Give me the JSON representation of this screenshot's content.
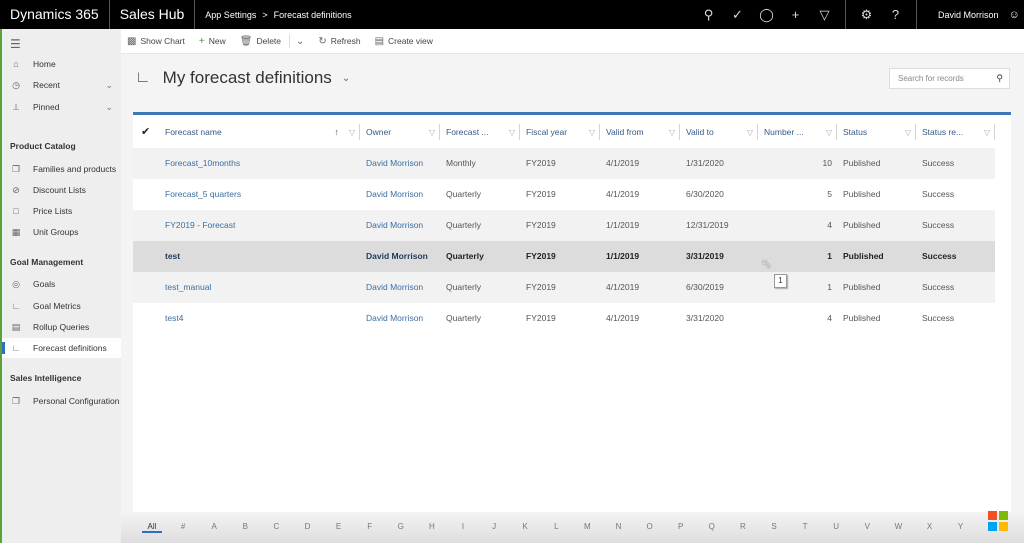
{
  "topbar": {
    "brand": "Dynamics 365",
    "app": "Sales Hub",
    "breadcrumb": [
      "App Settings",
      "Forecast definitions"
    ],
    "breadcrumb_sep": ">",
    "icons": [
      "search-icon",
      "task-icon",
      "lightbulb-icon",
      "plus-icon",
      "filter-icon",
      "gear-icon",
      "help-icon"
    ],
    "user": "David Morrison"
  },
  "sidebar": {
    "nav": [
      {
        "label": "Home",
        "icon": "home-icon"
      },
      {
        "label": "Recent",
        "icon": "clock-icon",
        "expandable": true
      },
      {
        "label": "Pinned",
        "icon": "pin-icon",
        "expandable": true
      }
    ],
    "sections": [
      {
        "title": "Product Catalog",
        "items": [
          {
            "label": "Families and products",
            "icon": "box-icon"
          },
          {
            "label": "Discount Lists",
            "icon": "discount-icon"
          },
          {
            "label": "Price Lists",
            "icon": "price-list-icon"
          },
          {
            "label": "Unit Groups",
            "icon": "unit-group-icon"
          }
        ]
      },
      {
        "title": "Goal Management",
        "items": [
          {
            "label": "Goals",
            "icon": "target-icon"
          },
          {
            "label": "Goal Metrics",
            "icon": "chart-line-icon"
          },
          {
            "label": "Rollup Queries",
            "icon": "document-icon"
          },
          {
            "label": "Forecast definitions",
            "icon": "forecast-icon",
            "active": true
          }
        ]
      },
      {
        "title": "Sales Intelligence",
        "items": [
          {
            "label": "Personal Configuration",
            "icon": "box-icon"
          }
        ]
      }
    ]
  },
  "commandbar": {
    "show_chart": "Show Chart",
    "new": "New",
    "delete": "Delete",
    "refresh": "Refresh",
    "create_view": "Create view"
  },
  "view": {
    "title": "My forecast definitions",
    "search_placeholder": "Search for records"
  },
  "grid": {
    "columns": [
      "Forecast name",
      "Owner",
      "Forecast ...",
      "Fiscal year",
      "Valid from",
      "Valid to",
      "Number ...",
      "Status",
      "Status re..."
    ],
    "sorted_column": "Forecast name",
    "sort_direction": "ascending",
    "rows": [
      {
        "name": "Forecast_10months",
        "owner": "David Morrison",
        "period": "Monthly",
        "fiscal_year": "FY2019",
        "valid_from": "4/1/2019",
        "valid_to": "1/31/2020",
        "number": "10",
        "status": "Published",
        "status_reason": "Success"
      },
      {
        "name": "Forecast_5 quarters",
        "owner": "David Morrison",
        "period": "Quarterly",
        "fiscal_year": "FY2019",
        "valid_from": "4/1/2019",
        "valid_to": "6/30/2020",
        "number": "5",
        "status": "Published",
        "status_reason": "Success"
      },
      {
        "name": "FY2019 - Forecast",
        "owner": "David Morrison",
        "period": "Quarterly",
        "fiscal_year": "FY2019",
        "valid_from": "1/1/2019",
        "valid_to": "12/31/2019",
        "number": "4",
        "status": "Published",
        "status_reason": "Success"
      },
      {
        "name": "test",
        "owner": "David Morrison",
        "period": "Quarterly",
        "fiscal_year": "FY2019",
        "valid_from": "1/1/2019",
        "valid_to": "3/31/2019",
        "number": "1",
        "status": "Published",
        "status_reason": "Success",
        "selected": true
      },
      {
        "name": "test_manual",
        "owner": "David Morrison",
        "period": "Quarterly",
        "fiscal_year": "FY2019",
        "valid_from": "4/1/2019",
        "valid_to": "6/30/2019",
        "number": "1",
        "status": "Published",
        "status_reason": "Success"
      },
      {
        "name": "test4",
        "owner": "David Morrison",
        "period": "Quarterly",
        "fiscal_year": "FY2019",
        "valid_from": "4/1/2019",
        "valid_to": "3/31/2020",
        "number": "4",
        "status": "Published",
        "status_reason": "Success"
      }
    ],
    "tooltip": "1"
  },
  "alphabet": {
    "letters": [
      "All",
      "#",
      "A",
      "B",
      "C",
      "D",
      "E",
      "F",
      "G",
      "H",
      "I",
      "J",
      "K",
      "L",
      "M",
      "N",
      "O",
      "P",
      "Q",
      "R",
      "S",
      "T",
      "U",
      "V",
      "W",
      "X",
      "Y"
    ],
    "active": "All"
  },
  "colors": {
    "accent": "#3d78b6",
    "link": "#3b6e9f",
    "sidebar_edge": "#5aa33b"
  }
}
